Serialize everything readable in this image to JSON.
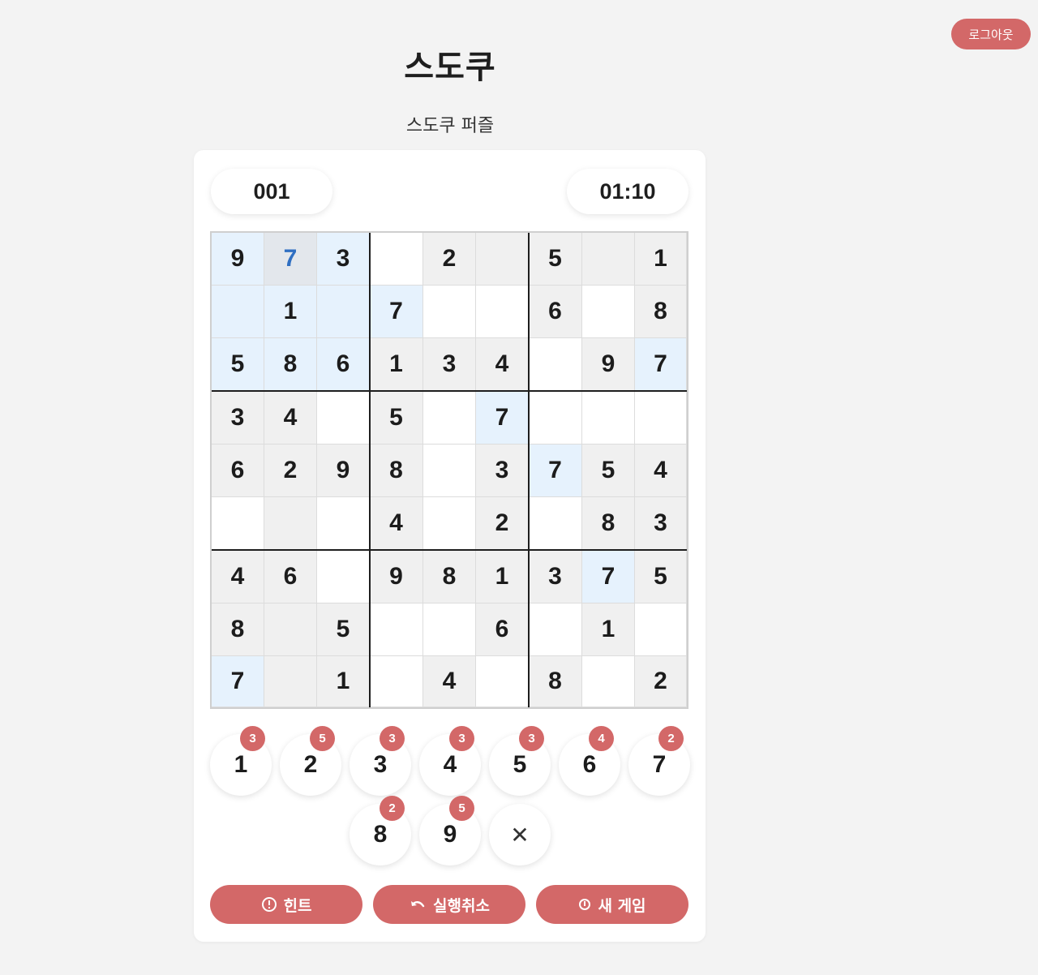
{
  "header": {
    "logout_label": "로그아웃",
    "title": "스도쿠",
    "subtitle": "스도쿠 퍼즐"
  },
  "status": {
    "level": "001",
    "timer": "01:10"
  },
  "grid": [
    [
      "9",
      "7",
      "3",
      "",
      "2",
      "",
      "5",
      "",
      "1"
    ],
    [
      "",
      "1",
      "",
      "7",
      "",
      "",
      "6",
      "",
      "8"
    ],
    [
      "5",
      "8",
      "6",
      "1",
      "3",
      "4",
      "",
      "9",
      "7"
    ],
    [
      "3",
      "4",
      "",
      "5",
      "",
      "7",
      "",
      "",
      ""
    ],
    [
      "6",
      "2",
      "9",
      "8",
      "",
      "3",
      "7",
      "5",
      "4"
    ],
    [
      "",
      "",
      "",
      "4",
      "",
      "2",
      "",
      "8",
      "3"
    ],
    [
      "4",
      "6",
      "",
      "9",
      "8",
      "1",
      "3",
      "7",
      "5"
    ],
    [
      "8",
      "",
      "5",
      "",
      "",
      "6",
      "",
      "1",
      ""
    ],
    [
      "7",
      "",
      "1",
      "",
      "4",
      "",
      "8",
      "",
      "2"
    ]
  ],
  "cell_states": [
    [
      "hl",
      "sel",
      "hl",
      "empty",
      "given",
      "given",
      "given",
      "given",
      "given"
    ],
    [
      "hl",
      "hl",
      "hl",
      "hl",
      "empty",
      "empty",
      "given",
      "empty",
      "given"
    ],
    [
      "hl",
      "hl",
      "hl",
      "given",
      "given",
      "given",
      "empty",
      "given",
      "hl"
    ],
    [
      "given",
      "given",
      "empty",
      "given",
      "empty",
      "hl",
      "empty",
      "empty",
      "empty"
    ],
    [
      "given",
      "given",
      "given",
      "given",
      "empty",
      "given",
      "hl",
      "given",
      "given"
    ],
    [
      "empty",
      "given",
      "empty",
      "given",
      "empty",
      "given",
      "empty",
      "given",
      "given"
    ],
    [
      "given",
      "given",
      "empty",
      "given",
      "given",
      "given",
      "given",
      "hl",
      "given"
    ],
    [
      "given",
      "given",
      "given",
      "empty",
      "empty",
      "given",
      "empty",
      "given",
      "empty"
    ],
    [
      "hl",
      "given",
      "given",
      "empty",
      "given",
      "empty",
      "given",
      "empty",
      "given"
    ]
  ],
  "selected_cell": {
    "row": 1,
    "col": 2,
    "value": "7"
  },
  "numpad": [
    {
      "label": "1",
      "remaining": "3"
    },
    {
      "label": "2",
      "remaining": "5"
    },
    {
      "label": "3",
      "remaining": "3"
    },
    {
      "label": "4",
      "remaining": "3"
    },
    {
      "label": "5",
      "remaining": "3"
    },
    {
      "label": "6",
      "remaining": "4"
    },
    {
      "label": "7",
      "remaining": "2"
    },
    {
      "label": "8",
      "remaining": "2"
    },
    {
      "label": "9",
      "remaining": "5"
    }
  ],
  "erase": {
    "label": "✕",
    "icon": "close-icon"
  },
  "actions": {
    "hint_label": "힌트",
    "hint_icon": "alert-circle-icon",
    "undo_label": "실행취소",
    "undo_icon": "undo-icon",
    "new_game_label": "새 게임",
    "new_game_icon": "power-icon"
  },
  "colors": {
    "accent": "#d36868",
    "highlight": "#e6f2fd",
    "given_bg": "#f0f0f0",
    "selected_text": "#2f6fc2"
  }
}
